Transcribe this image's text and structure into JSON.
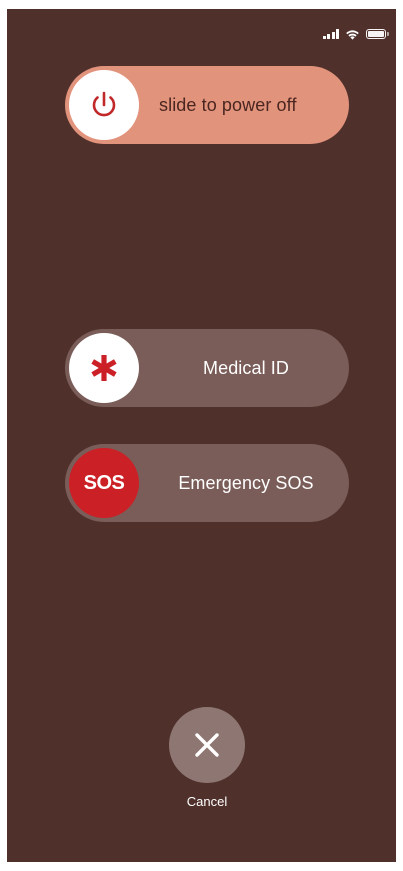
{
  "status_bar": {
    "signal_icon": "cellular-signal-icon",
    "wifi_icon": "wifi-icon",
    "battery_icon": "battery-icon",
    "battery_level": 1.0
  },
  "power_slider": {
    "icon": "power-icon",
    "label": "slide to power off",
    "track_color": "#e2937c",
    "icon_color": "#c0282a"
  },
  "medical_id_slider": {
    "icon": "asterisk-icon",
    "label": "Medical ID",
    "icon_color": "#cc2027"
  },
  "emergency_sos_slider": {
    "knob_text": "SOS",
    "label": "Emergency SOS",
    "knob_color": "#cc2027"
  },
  "cancel": {
    "icon": "close-icon",
    "label": "Cancel"
  },
  "colors": {
    "background": "#4f302b",
    "track": "#7a5d58",
    "cancel_button": "#8e7772"
  }
}
